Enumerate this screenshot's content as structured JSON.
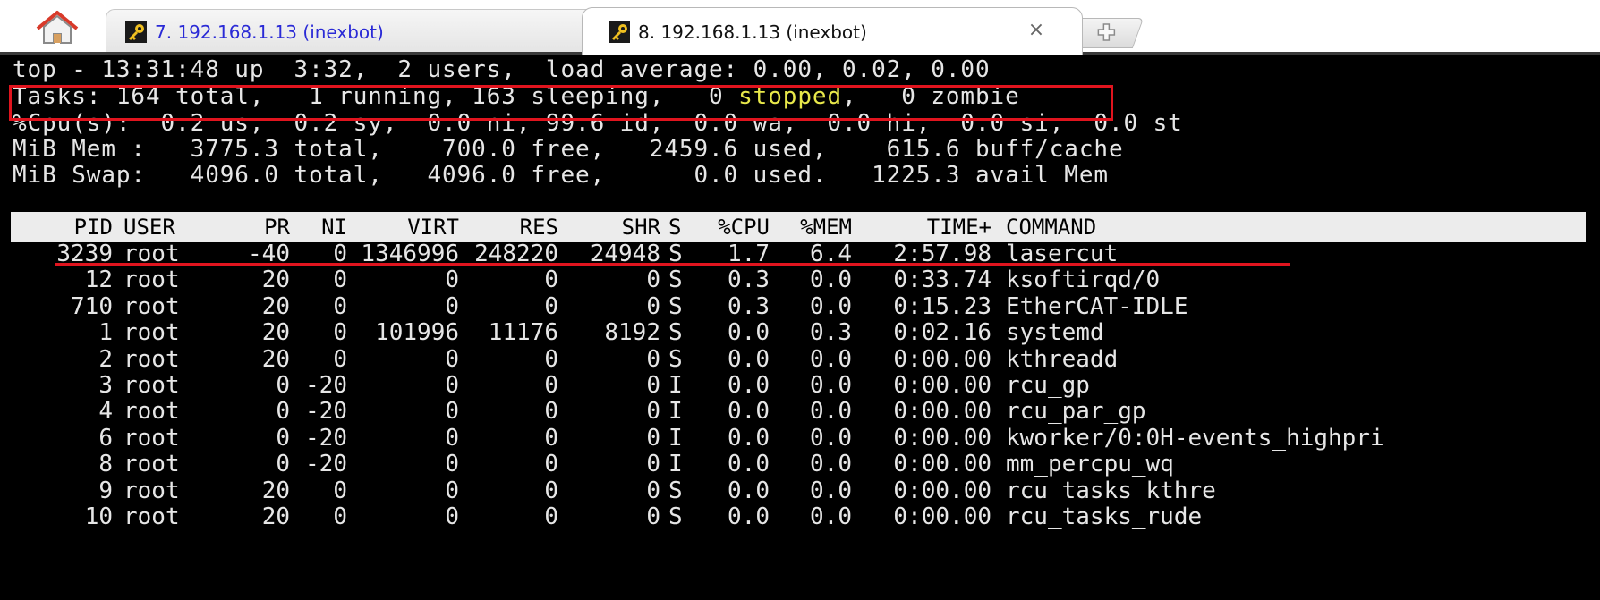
{
  "tabs": [
    {
      "label": "7. 192.168.1.13 (inexbot)",
      "active": false
    },
    {
      "label": "8. 192.168.1.13 (inexbot)",
      "active": true
    }
  ],
  "icons": {
    "home": "home-icon",
    "tab": "key-icon",
    "close": "close-icon",
    "new_tab": "plus-icon"
  },
  "colors": {
    "annotation": "#e0141e",
    "stopped_highlight": "#e8e84a",
    "terminal_bg": "#000000",
    "header_bg": "#ececec"
  },
  "summary": {
    "line1": "top - 13:31:48 up  3:32,  2 users,  load average: 0.00, 0.02, 0.00",
    "tasks_a": "Tasks: 164 total,   1 running, 163 sleeping,   0 ",
    "tasks_stopped": "stopped",
    "tasks_b": ",   0 zombie",
    "cpu": "%Cpu(s):  0.2 us,  0.2 sy,  0.0 ni, 99.6 id,  0.0 wa,  0.0 hi,  0.0 si,  0.0 st",
    "mem": "MiB Mem :   3775.3 total,    700.0 free,   2459.6 used,    615.6 buff/cache",
    "swap": "MiB Swap:   4096.0 total,   4096.0 free,      0.0 used.   1225.3 avail Mem"
  },
  "columns": [
    "PID",
    "USER",
    "PR",
    "NI",
    "VIRT",
    "RES",
    "SHR",
    "S",
    "%CPU",
    "%MEM",
    "TIME+",
    "COMMAND"
  ],
  "processes": [
    [
      "3239",
      "root",
      "-40",
      "0",
      "1346996",
      "248220",
      "24948",
      "S",
      "1.7",
      "6.4",
      "2:57.98",
      "lasercut"
    ],
    [
      "12",
      "root",
      "20",
      "0",
      "0",
      "0",
      "0",
      "S",
      "0.3",
      "0.0",
      "0:33.74",
      "ksoftirqd/0"
    ],
    [
      "710",
      "root",
      "20",
      "0",
      "0",
      "0",
      "0",
      "S",
      "0.3",
      "0.0",
      "0:15.23",
      "EtherCAT-IDLE"
    ],
    [
      "1",
      "root",
      "20",
      "0",
      "101996",
      "11176",
      "8192",
      "S",
      "0.0",
      "0.3",
      "0:02.16",
      "systemd"
    ],
    [
      "2",
      "root",
      "20",
      "0",
      "0",
      "0",
      "0",
      "S",
      "0.0",
      "0.0",
      "0:00.00",
      "kthreadd"
    ],
    [
      "3",
      "root",
      "0",
      "-20",
      "0",
      "0",
      "0",
      "I",
      "0.0",
      "0.0",
      "0:00.00",
      "rcu_gp"
    ],
    [
      "4",
      "root",
      "0",
      "-20",
      "0",
      "0",
      "0",
      "I",
      "0.0",
      "0.0",
      "0:00.00",
      "rcu_par_gp"
    ],
    [
      "6",
      "root",
      "0",
      "-20",
      "0",
      "0",
      "0",
      "I",
      "0.0",
      "0.0",
      "0:00.00",
      "kworker/0:0H-events_highpri"
    ],
    [
      "8",
      "root",
      "0",
      "-20",
      "0",
      "0",
      "0",
      "I",
      "0.0",
      "0.0",
      "0:00.00",
      "mm_percpu_wq"
    ],
    [
      "9",
      "root",
      "20",
      "0",
      "0",
      "0",
      "0",
      "S",
      "0.0",
      "0.0",
      "0:00.00",
      "rcu_tasks_kthre"
    ],
    [
      "10",
      "root",
      "20",
      "0",
      "0",
      "0",
      "0",
      "S",
      "0.0",
      "0.0",
      "0:00.00",
      "rcu_tasks_rude"
    ]
  ]
}
